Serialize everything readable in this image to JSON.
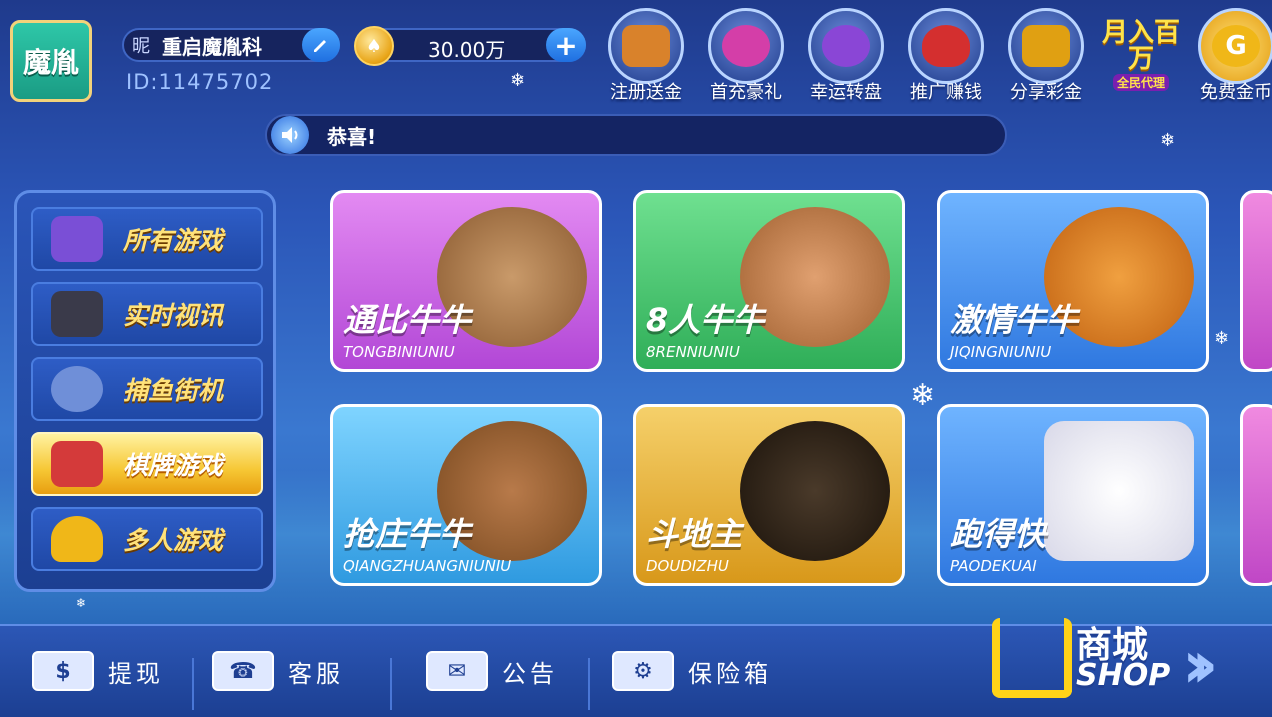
{
  "player": {
    "avatar_label": "魔胤",
    "nick_label": "昵",
    "nickname": "重启魔胤科",
    "id_text": "ID:11475702",
    "coins": "30.00万"
  },
  "top_icons": [
    {
      "label": "注册送金",
      "icon": "treasure-chest-icon",
      "color": "#d9822b"
    },
    {
      "label": "首充豪礼",
      "icon": "prize-wheel-icon",
      "color": "#d43ea8"
    },
    {
      "label": "幸运转盘",
      "icon": "lucky-wheel-icon",
      "color": "#8a46d6"
    },
    {
      "label": "推广赚钱",
      "icon": "money-bag-icon",
      "color": "#d42f2f"
    },
    {
      "label": "分享彩金",
      "icon": "gold-chest-icon",
      "color": "#e0a012"
    },
    {
      "label": "免费金币",
      "icon": "gold-coin-g-icon",
      "color": "#f0b718"
    }
  ],
  "monthly_promo": {
    "main": "月入百万",
    "sub": "全民代理"
  },
  "notice": {
    "text": "恭喜!"
  },
  "categories": [
    {
      "label": "所有游戏",
      "icon": "cards-hat-icon",
      "active": false
    },
    {
      "label": "实时视讯",
      "icon": "tv-dealer-icon",
      "active": false
    },
    {
      "label": "捕鱼街机",
      "icon": "shark-icon",
      "active": false
    },
    {
      "label": "棋牌游戏",
      "icon": "cards-chips-icon",
      "active": true
    },
    {
      "label": "多人游戏",
      "icon": "trophy-icon",
      "active": false
    }
  ],
  "games": [
    {
      "title": "通比牛牛",
      "pinyin": "TONGBINIUNIU",
      "color": "#c75ae0"
    },
    {
      "title": "8人牛牛",
      "pinyin": "8RENNIUNIU",
      "color": "#3fbf6a"
    },
    {
      "title": "激情牛牛",
      "pinyin": "JIQINGNIUNIU",
      "color": "#3f8ee6"
    },
    {
      "title": "抢庄牛牛",
      "pinyin": "QIANGZHUANGNIUNIU",
      "color": "#37a9e6"
    },
    {
      "title": "斗地主",
      "pinyin": "DOUDIZHU",
      "color": "#e8b42a"
    },
    {
      "title": "跑得快",
      "pinyin": "PAODEKUAI",
      "color": "#3f8ee6"
    }
  ],
  "bottom_nav": [
    {
      "label": "提现",
      "icon": "withdraw-icon"
    },
    {
      "label": "客服",
      "icon": "phone-icon"
    },
    {
      "label": "公告",
      "icon": "mail-icon"
    },
    {
      "label": "保险箱",
      "icon": "safe-icon"
    }
  ],
  "shop": {
    "label_cn": "商城",
    "label_en": "SHOP"
  }
}
